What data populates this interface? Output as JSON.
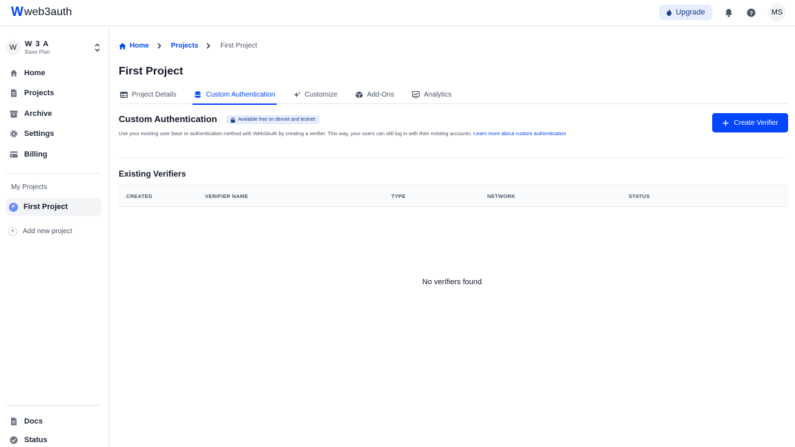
{
  "app": {
    "logo_mark": "W",
    "logo_text": "web3auth"
  },
  "topbar": {
    "upgrade_label": "Upgrade",
    "avatar_initials": "MS"
  },
  "sidebar": {
    "org": {
      "avatar": "W",
      "name": "W 3 A",
      "plan": "Base Plan"
    },
    "nav": [
      {
        "label": "Home",
        "icon": "home-icon"
      },
      {
        "label": "Projects",
        "icon": "document-icon"
      },
      {
        "label": "Archive",
        "icon": "archive-icon"
      },
      {
        "label": "Settings",
        "icon": "gear-icon"
      },
      {
        "label": "Billing",
        "icon": "credit-card-icon"
      }
    ],
    "my_projects_label": "My Projects",
    "project": {
      "badge": "F",
      "name": "First Project"
    },
    "add_project_label": "Add new project",
    "footer": [
      {
        "label": "Docs",
        "icon": "document-icon"
      },
      {
        "label": "Status",
        "icon": "check-circle-icon"
      }
    ]
  },
  "breadcrumb": {
    "home": "Home",
    "projects": "Projects",
    "current": "First Project"
  },
  "page": {
    "title": "First Project",
    "tabs": [
      {
        "label": "Project Details",
        "icon": "table-icon",
        "active": false
      },
      {
        "label": "Custom Authentication",
        "icon": "database-icon",
        "active": true
      },
      {
        "label": "Customize",
        "icon": "sparkles-icon",
        "active": false
      },
      {
        "label": "Add-Ons",
        "icon": "cube-icon",
        "active": false
      },
      {
        "label": "Analytics",
        "icon": "chart-icon",
        "active": false
      }
    ]
  },
  "custom_auth": {
    "title": "Custom Authentication",
    "badge": "Available free on devnet and testnet",
    "description": "Use your existing user base or authentication method with Web3Auth by creating a verifier. This way, your users can still log in with their existing accounts.",
    "learn_more": "Learn more about custom authentication",
    "create_button": "Create Verifier"
  },
  "verifiers": {
    "title": "Existing Verifiers",
    "columns": [
      "CREATED",
      "VERIFIER NAME",
      "TYPE",
      "NETWORK",
      "STATUS"
    ],
    "empty_message": "No verifiers found"
  },
  "colors": {
    "primary": "#0346ff",
    "badge_bg": "#e5edff"
  }
}
